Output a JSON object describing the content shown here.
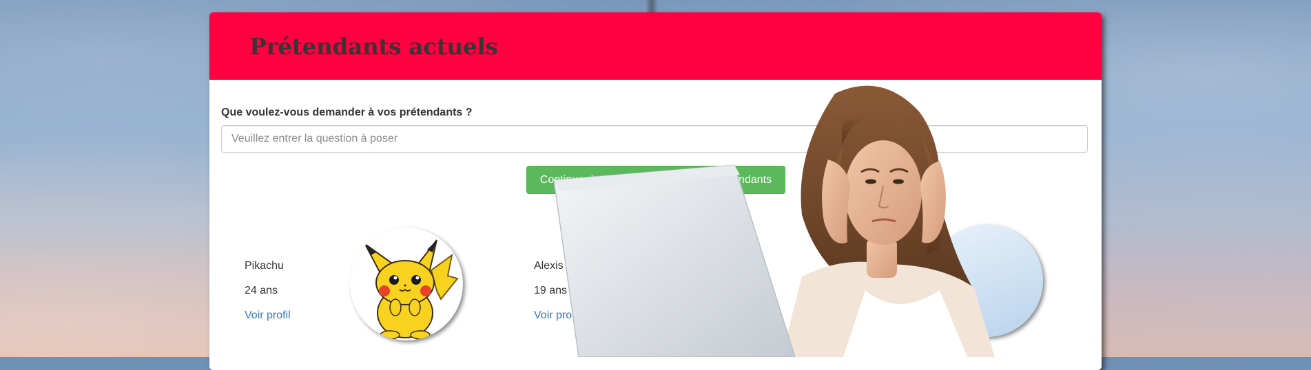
{
  "panel": {
    "title": "Prétendants actuels",
    "question_label": "Que voulez-vous demander à vos prétendants ?",
    "question_placeholder": "Veuillez entrer la question à poser",
    "question_value": "",
    "continue_label": "Continuer le tournaments avec ces prétendants"
  },
  "suitors": [
    {
      "name": "Pikachu",
      "age": "24 ans",
      "link": "Voir profil",
      "avatar_icon": "pikachu-avatar"
    },
    {
      "name": "Alexis",
      "age": "19 ans",
      "link": "Voir pro",
      "avatar_icon": "person-avatar"
    }
  ],
  "colors": {
    "header": "#ff0040",
    "title_text": "#3a3434",
    "button": "#5cb85c",
    "link": "#337ab7"
  }
}
